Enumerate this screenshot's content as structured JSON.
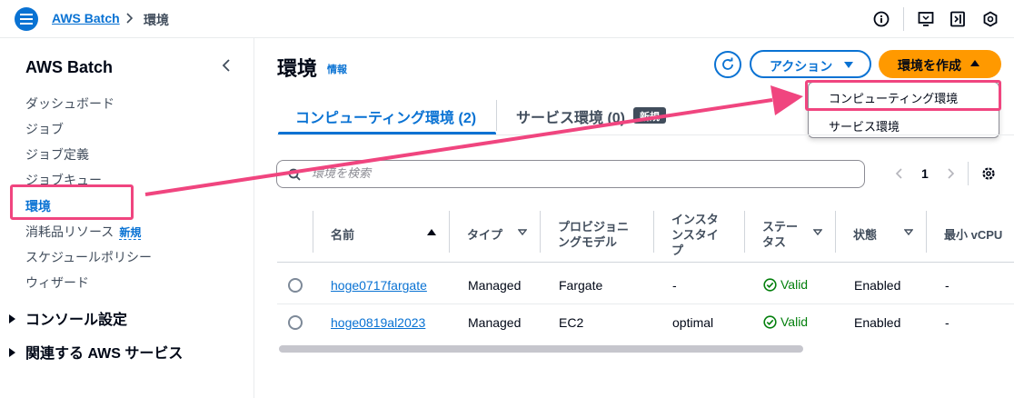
{
  "topbar": {
    "breadcrumb_root": "AWS Batch",
    "breadcrumb_current": "環境",
    "icons": [
      "info-icon",
      "screen-icon",
      "panel-icon",
      "settings-icon"
    ]
  },
  "sidebar": {
    "title": "AWS Batch",
    "items": [
      {
        "label": "ダッシュボード"
      },
      {
        "label": "ジョブ"
      },
      {
        "label": "ジョブ定義"
      },
      {
        "label": "ジョブキュー"
      },
      {
        "label": "環境",
        "active": true
      },
      {
        "label": "消耗品リソース",
        "badge": "新規"
      },
      {
        "label": "スケジュールポリシー"
      },
      {
        "label": "ウィザード"
      }
    ],
    "sections": [
      {
        "label": "コンソール設定"
      },
      {
        "label": "関連する AWS サービス"
      }
    ]
  },
  "header": {
    "title": "環境",
    "info": "情報",
    "actions_label": "アクション",
    "create_label": "環境を作成"
  },
  "dropdown": {
    "items": [
      "コンピューティング環境",
      "サービス環境"
    ]
  },
  "tabs": [
    {
      "label": "コンピューティング環境 (2)",
      "active": true
    },
    {
      "label": "サービス環境 (0)",
      "badge": "新規"
    }
  ],
  "search": {
    "placeholder": "環境を検索",
    "value": ""
  },
  "pagination": {
    "current_page": "1"
  },
  "table": {
    "columns": [
      "名前",
      "タイプ",
      "プロビジョニングモデル",
      "インスタンスタイプ",
      "ステータス",
      "状態",
      "最小 vCPU"
    ],
    "rows": [
      {
        "name": "hoge0717fargate",
        "type": "Managed",
        "provisioning": "Fargate",
        "instance_type": "-",
        "status": "Valid",
        "state": "Enabled",
        "min_vcpu": "-"
      },
      {
        "name": "hoge0819al2023",
        "type": "Managed",
        "provisioning": "EC2",
        "instance_type": "optimal",
        "status": "Valid",
        "state": "Enabled",
        "min_vcpu": "-"
      }
    ]
  },
  "colors": {
    "accent": "#0972d3",
    "primary_button": "#ff9900",
    "annotation": "#f0457f",
    "success": "#037f0c"
  }
}
